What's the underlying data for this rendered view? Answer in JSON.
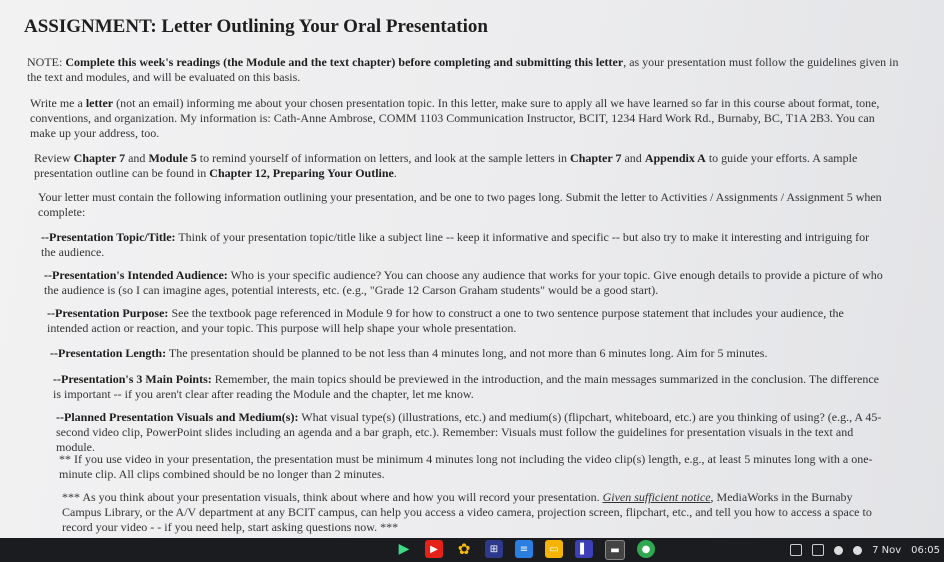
{
  "title": "ASSIGNMENT: Letter Outlining Your Oral Presentation",
  "note": {
    "prefix": "NOTE: ",
    "bold": "Complete this week's readings (the Module and the text chapter) before completing and submitting this letter",
    "rest": ", as your presentation must follow the guidelines given in the text and modules, and will be evaluated on this basis."
  },
  "write": {
    "a": "Write me a ",
    "b": "letter",
    "c": " (not an email) informing me about your chosen presentation topic. In this letter, make sure to apply all we have learned so far in this course about format, tone, conventions, and organization. My information is: Cath-Anne Ambrose, COMM 1103 Communication Instructor, BCIT, 1234 Hard Work Rd., Burnaby, BC, T1A 2B3. You can make up your address, too."
  },
  "review": {
    "a": "Review ",
    "b": "Chapter 7",
    "c": " and ",
    "d": "Module 5",
    "e": " to remind yourself of information on letters, and look at the sample letters in ",
    "f": "Chapter 7",
    "g": " and ",
    "h": "Appendix A",
    "i": " to guide your efforts. A sample presentation outline can be found in ",
    "j": "Chapter 12, Preparing Your Outline",
    "k": "."
  },
  "must_contain": "Your letter must contain the following information outlining your presentation, and be one to two pages long. Submit the letter to Activities / Assignments / Assignment 5 when complete:",
  "items": [
    {
      "label": "--Presentation Topic/Title:",
      "text": " Think of your presentation topic/title like a subject line -- keep it informative and specific -- but also try to make it interesting and intriguing for the audience."
    },
    {
      "label": "--Presentation's Intended Audience:",
      "text": " Who is your specific audience? You can choose any audience that works for your topic. Give enough details to provide a picture of who the audience is (so I can imagine ages, potential interests, etc. (e.g., \"Grade 12 Carson Graham students\" would be a good start)."
    },
    {
      "label": "--Presentation Purpose:",
      "text": " See the textbook page referenced in Module 9 for how to construct a one to two sentence purpose statement that includes your audience, the intended action or reaction, and your topic. This purpose will help shape your whole presentation."
    },
    {
      "label": "--Presentation Length:",
      "text": " The presentation should be planned to be not less than 4 minutes long, and not more than 6 minutes long. Aim for 5 minutes."
    },
    {
      "label": "--Presentation's 3 Main Points:",
      "text": " Remember, the main topics should be previewed in the introduction, and the main messages summarized in the conclusion. The difference is important -- if you aren't clear after reading the Module and the chapter, let me know."
    },
    {
      "label": "--Planned Presentation Visuals and Medium(s):",
      "text": " What visual type(s) (illustrations, etc.) and medium(s) (flipchart, whiteboard, etc.) are you thinking of using? (e.g., A 45-second video clip, PowerPoint slides including an agenda and a bar graph, etc.). Remember: Visuals must follow the guidelines for presentation visuals in the text and module."
    }
  ],
  "video_note": "** If you use video in your presentation, the presentation must be minimum 4 minutes long not including the video clip(s) length, e.g., at least 5 minutes long with a one-minute clip. All clips combined should be no longer than 2 minutes.",
  "visuals_note": {
    "a": "*** As you think about your presentation visuals, think about where and how you will record your presentation. ",
    "u": "Given sufficient notice",
    "b": ", MediaWorks in the Burnaby Campus Library, or the A/V department at any BCIT campus, can help you access a video camera, projection screen, flipchart, etc., and tell you how to access a space to record your video - - if you need help, start asking questions now. ***"
  },
  "taskbar": {
    "icons": [
      "play-store-icon",
      "youtube-icon",
      "photos-icon",
      "calculator-icon",
      "docs-icon",
      "slides-icon",
      "purple-app-icon",
      "screen-icon",
      "green-app-icon"
    ],
    "date": "7 Nov",
    "time": "06:05"
  }
}
